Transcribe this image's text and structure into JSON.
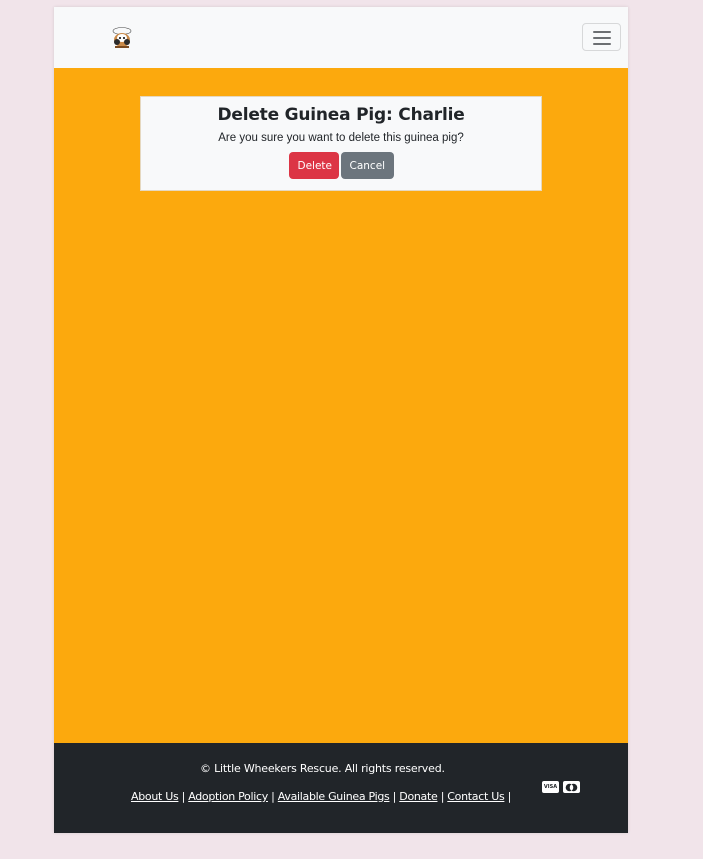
{
  "navbar": {
    "logo_alt": "Little Wheekers Rescue logo",
    "toggler_label": "Toggle navigation"
  },
  "confirm": {
    "title": "Delete Guinea Pig: Charlie",
    "message": "Are you sure you want to delete this guinea pig?",
    "delete_label": "Delete",
    "cancel_label": "Cancel"
  },
  "footer": {
    "copyright": "© Little Wheekers Rescue. All rights reserved.",
    "links": [
      {
        "label": "About Us"
      },
      {
        "label": "Adoption Policy"
      },
      {
        "label": "Available Guinea Pigs"
      },
      {
        "label": "Donate"
      },
      {
        "label": "Contact Us"
      }
    ],
    "separator": "|",
    "payment_icons": [
      "visa-icon",
      "mastercard-icon"
    ],
    "visa_text": "VISA"
  },
  "colors": {
    "page_bg": "#f1e4ea",
    "navbar_bg": "#f8f9fa",
    "main_bg": "#fca90d",
    "footer_bg": "#212529",
    "danger": "#dc3545",
    "secondary": "#6c757d"
  }
}
